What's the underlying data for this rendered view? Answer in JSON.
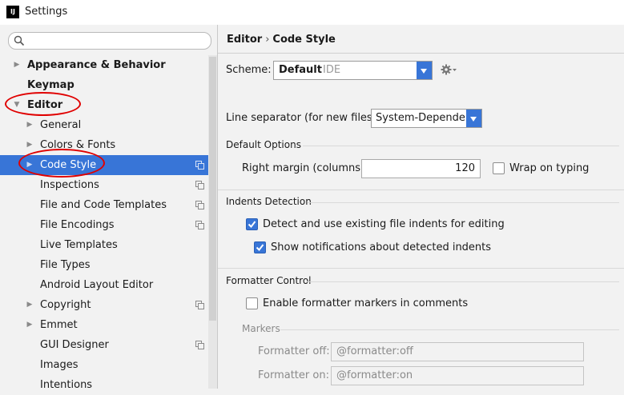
{
  "window": {
    "title": "Settings",
    "app_icon": "IJ"
  },
  "sidebar": {
    "search": {
      "placeholder": "",
      "value": ""
    },
    "items": [
      {
        "label": "Appearance & Behavior"
      },
      {
        "label": "Keymap"
      },
      {
        "label": "Editor"
      },
      {
        "label": "General"
      },
      {
        "label": "Colors & Fonts"
      },
      {
        "label": "Code Style"
      },
      {
        "label": "Inspections"
      },
      {
        "label": "File and Code Templates"
      },
      {
        "label": "File Encodings"
      },
      {
        "label": "Live Templates"
      },
      {
        "label": "File Types"
      },
      {
        "label": "Android Layout Editor"
      },
      {
        "label": "Copyright"
      },
      {
        "label": "Emmet"
      },
      {
        "label": "GUI Designer"
      },
      {
        "label": "Images"
      },
      {
        "label": "Intentions"
      }
    ]
  },
  "main": {
    "breadcrumb": {
      "parent": "Editor",
      "separator": "›",
      "current": "Code Style"
    },
    "scheme": {
      "label": "Scheme:",
      "value": "Default",
      "tag": "IDE"
    },
    "line_separator": {
      "label": "Line separator (for new files):",
      "value": "System-Dependent"
    },
    "default_options": {
      "heading": "Default Options",
      "right_margin_label": "Right margin (columns):",
      "right_margin_value": "120",
      "wrap_on_typing": {
        "label": "Wrap on typing",
        "checked": false
      }
    },
    "indents_detection": {
      "heading": "Indents Detection",
      "detect": {
        "label": "Detect and use existing file indents for editing",
        "checked": true
      },
      "notify": {
        "label": "Show notifications about detected indents",
        "checked": true
      }
    },
    "formatter_control": {
      "heading": "Formatter Control",
      "enable": {
        "label": "Enable formatter markers in comments",
        "checked": false
      },
      "markers_heading": "Markers",
      "off_label": "Formatter off:",
      "off_value": "@formatter:off",
      "on_label": "Formatter on:",
      "on_value": "@formatter:on"
    }
  },
  "colors": {
    "accent": "#3875d7",
    "annotation": "#e00000"
  }
}
